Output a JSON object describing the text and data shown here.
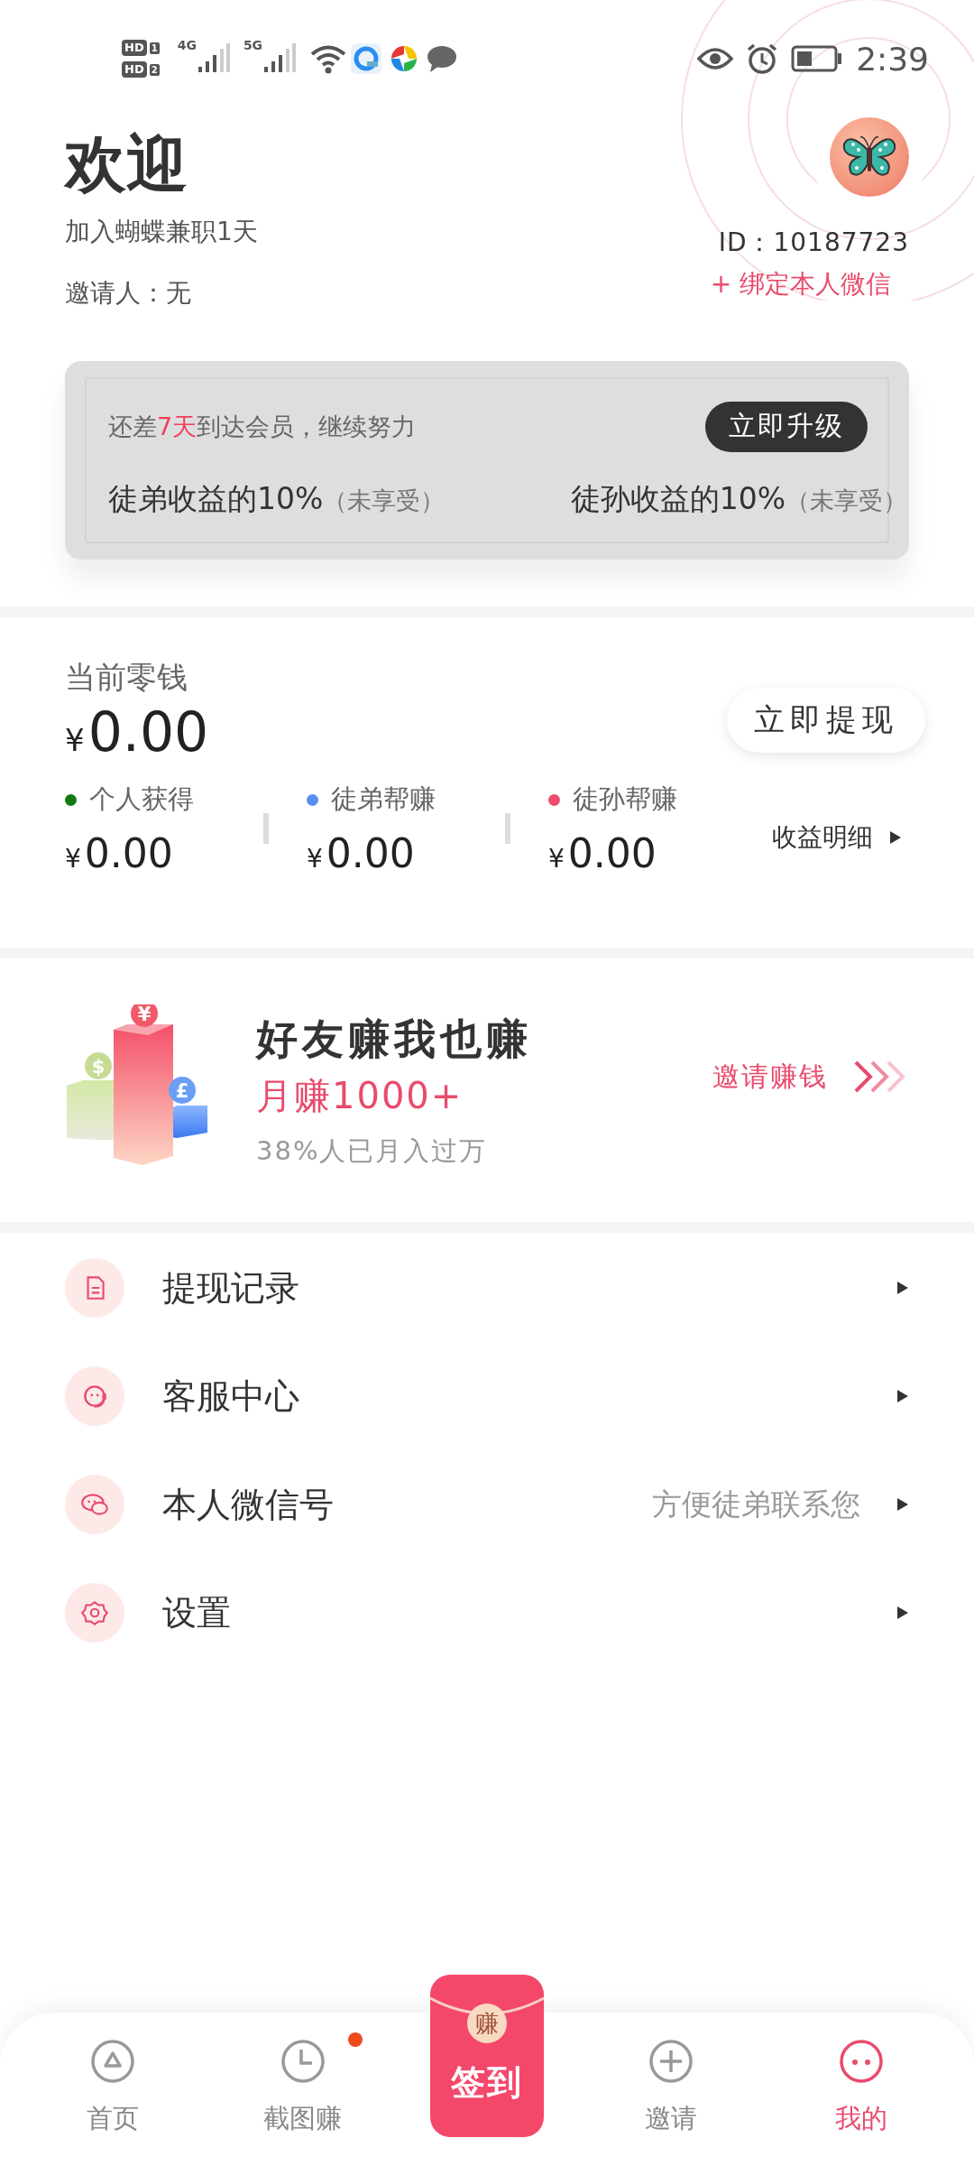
{
  "status_bar": {
    "sims": [
      {
        "label": "HD",
        "slot": "1"
      },
      {
        "label": "HD",
        "slot": "2"
      }
    ],
    "networks": [
      "4G",
      "5G"
    ],
    "time": "2:39"
  },
  "profile": {
    "title": "欢迎",
    "joined": "加入蝴蝶兼职1天",
    "inviter": "邀请人：无",
    "id": "ID：10187723",
    "bind_link": "+ 绑定本人微信"
  },
  "membership": {
    "notice": [
      {
        "text": "还差",
        "highlight": false
      },
      {
        "text": "7天",
        "highlight": true
      },
      {
        "text": "到达会员，继续努力",
        "highlight": false
      }
    ],
    "upgrade_button": "立即升级",
    "benefits": [
      {
        "label": "徒弟收益的10%",
        "status": "（未享受）"
      },
      {
        "label": "徒孙收益的10%",
        "status": "（未享受）"
      }
    ]
  },
  "wallet": {
    "title": "当前零钱",
    "currency": "¥",
    "amount": "0.00",
    "withdraw_button": "立即提现",
    "breakdown": [
      {
        "label": "个人获得",
        "color": "#137a13",
        "currency": "¥",
        "amount": "0.00"
      },
      {
        "label": "徒弟帮赚",
        "color": "#5a8df0",
        "currency": "¥",
        "amount": "0.00"
      },
      {
        "label": "徒孙帮赚",
        "color": "#ee4d6e",
        "currency": "¥",
        "amount": "0.00"
      }
    ],
    "details_link": "收益明细"
  },
  "invite_banner": {
    "coins": [
      "$",
      "¥",
      "£"
    ],
    "title": "好友赚我也赚",
    "subtitle": "月赚1000+",
    "note": "38%人已月入过万",
    "action": "邀请赚钱"
  },
  "menu": [
    {
      "label": "提现记录"
    },
    {
      "label": "客服中心"
    },
    {
      "label": "本人微信号",
      "hint": "方便徒弟联系您"
    },
    {
      "label": "设置"
    }
  ],
  "tab_bar": [
    {
      "kind": "tab",
      "label": "首页",
      "selected": false,
      "badge": false
    },
    {
      "kind": "tab",
      "label": "截图赚",
      "selected": false,
      "badge": true
    },
    {
      "kind": "envelope",
      "seal": "赚",
      "label": "签到",
      "selected": false,
      "badge": false
    },
    {
      "kind": "tab",
      "label": "邀请",
      "selected": false,
      "badge": false
    },
    {
      "kind": "tab",
      "label": "我的",
      "selected": true,
      "badge": false
    }
  ]
}
